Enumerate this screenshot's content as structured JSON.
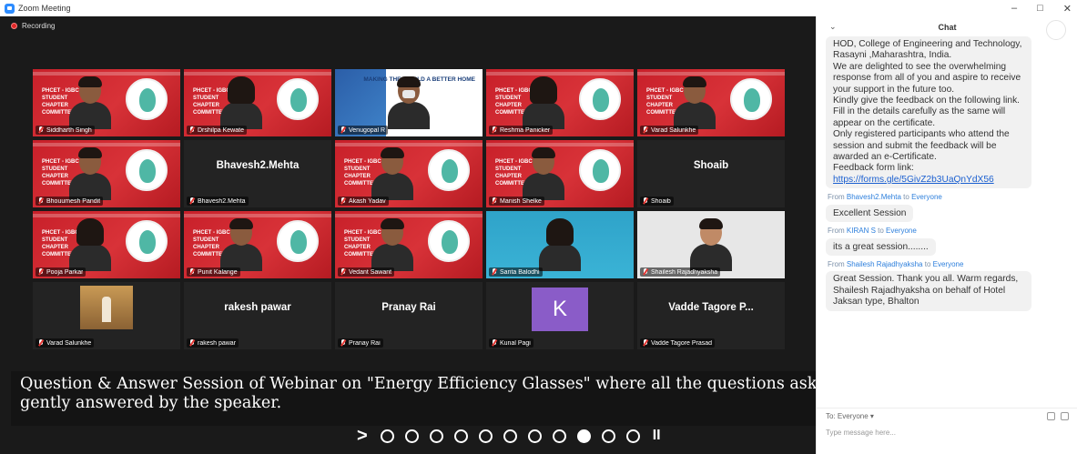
{
  "window": {
    "title": "Zoom Meeting",
    "controls": [
      "–",
      "□",
      "✕"
    ]
  },
  "recording_label": "Recording",
  "tiles": [
    {
      "name": "Siddharth Singh",
      "kind": "banner",
      "person": "male"
    },
    {
      "name": "Drshilpa Kewate",
      "kind": "banner",
      "person": "female"
    },
    {
      "name": "Venugopal R",
      "kind": "world",
      "person": "mask",
      "active": true,
      "banner_title": "MAKING THE WORLD A BETTER HOME"
    },
    {
      "name": "Reshma Panicker",
      "kind": "banner",
      "person": "female"
    },
    {
      "name": "Varad Salunkhe",
      "kind": "banner",
      "person": "male"
    },
    {
      "name": "Bhouumesh Pandit",
      "kind": "banner",
      "person": "male"
    },
    {
      "name": "Bhavesh2.Mehta",
      "kind": "text",
      "big": "Bhavesh2.Mehta"
    },
    {
      "name": "Akash Yadav",
      "kind": "banner",
      "person": "male"
    },
    {
      "name": "Manish Shelke",
      "kind": "banner",
      "person": "male"
    },
    {
      "name": "Shoaib",
      "kind": "text",
      "big": "Shoaib"
    },
    {
      "name": "Pooja Parkar",
      "kind": "banner",
      "person": "female"
    },
    {
      "name": "Punit Kalange",
      "kind": "banner",
      "person": "male"
    },
    {
      "name": "Vedant Sawant",
      "kind": "banner",
      "person": "male"
    },
    {
      "name": "Sarita Balodhi",
      "kind": "teal",
      "person": "female"
    },
    {
      "name": "Shailesh Rajadhyaksha",
      "kind": "grey",
      "person": "light"
    },
    {
      "name": "Varad Salunkhe",
      "kind": "picture"
    },
    {
      "name": "rakesh pawar",
      "kind": "text",
      "big": "rakesh pawar"
    },
    {
      "name": "Pranay Rai",
      "kind": "text",
      "big": "Pranay Rai"
    },
    {
      "name": "Kunal Pagi",
      "kind": "avatar",
      "letter": "K"
    },
    {
      "name": "Vadde Tagore Prasad",
      "kind": "text",
      "big": "Vadde Tagore P..."
    }
  ],
  "banner_text": "PHCET - IGBC STUDENT CHAPTER COMMITTEE",
  "caption": "Question & Answer Session of Webinar on \"Energy Efficiency Glasses\" where all the questions asked by the participants were gently answered by the speaker.",
  "carousel": {
    "arrow": ">",
    "dots": 11,
    "active_index": 8,
    "pause": "II"
  },
  "chat": {
    "title": "Chat",
    "main_message": "HOD, College of Engineering and Technology, Rasayni ,Maharashtra, India.\nWe are delighted to see the overwhelming response from all of you and aspire to receive your support in the future too.\nKindly give the feedback on the following link. Fill in the details carefully as the same will appear on the certificate.\nOnly registered participants who attend the session and submit the feedback will be awarded an e-Certificate.\nFeedback form link:",
    "link": "https://forms.gle/5GivZ2b3UaQnYdX56",
    "messages": [
      {
        "from": "Bhavesh2.Mehta",
        "to": "Everyone",
        "text": "Excellent Session"
      },
      {
        "from": "KIRAN S",
        "to": "Everyone",
        "text": "its a great session........"
      },
      {
        "from": "Shailesh Rajadhyaksha",
        "to": "Everyone",
        "text": "Great Session. Thank you all. Warm regards, Shailesh Rajadhyaksha on behalf of Hotel Jaksan type, Bhalton"
      }
    ],
    "from_word": "From",
    "to_word": "to",
    "send_to": "To: Everyone ▾",
    "input_placeholder": "Type message here..."
  }
}
